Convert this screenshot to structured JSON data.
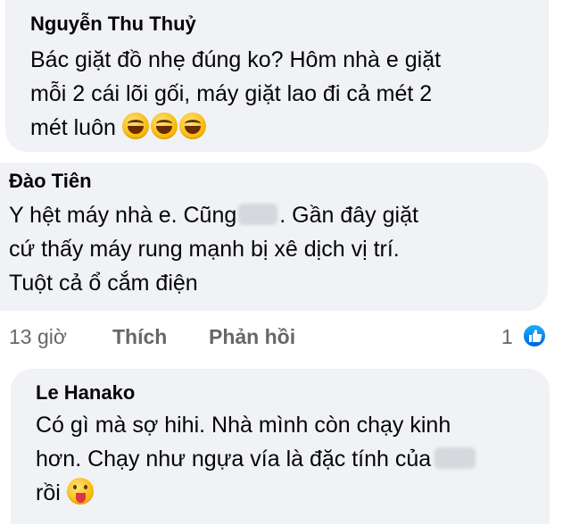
{
  "comments": [
    {
      "author": "Nguyễn Thu Thuỷ",
      "lines": [
        "Bác giặt đồ nhẹ đúng ko? Hôm nhà e giặt",
        "mỗi 2 cái lõi gối, máy giặt lao đi cả mét 2",
        "mét luôn "
      ],
      "emojis": [
        "laughing-emoji",
        "laughing-emoji",
        "laughing-emoji"
      ]
    },
    {
      "author": "Đào Tiên",
      "lines": [
        "Y hệt máy nhà e. Cũng",
        ". Gần đây giặt",
        "cứ thấy máy rung mạnh bị xê dịch vị trí.",
        "Tuột cả ổ cắm điện"
      ],
      "time": "13 giờ",
      "like_action": "Thích",
      "reply_action": "Phản hồi",
      "like_count": "1"
    },
    {
      "author": "Le Hanako",
      "lines": [
        "Có gì mà sợ hihi. Nhà mình còn chạy kinh",
        "hơn. Chạy như ngựa vía là đặc tính của",
        "rồi "
      ],
      "emojis": [
        "tongue-wink-emoji"
      ]
    }
  ],
  "colors": {
    "bubble": "#f0f2f5",
    "meta_text": "#65676b",
    "like_blue": "#0866ff"
  }
}
